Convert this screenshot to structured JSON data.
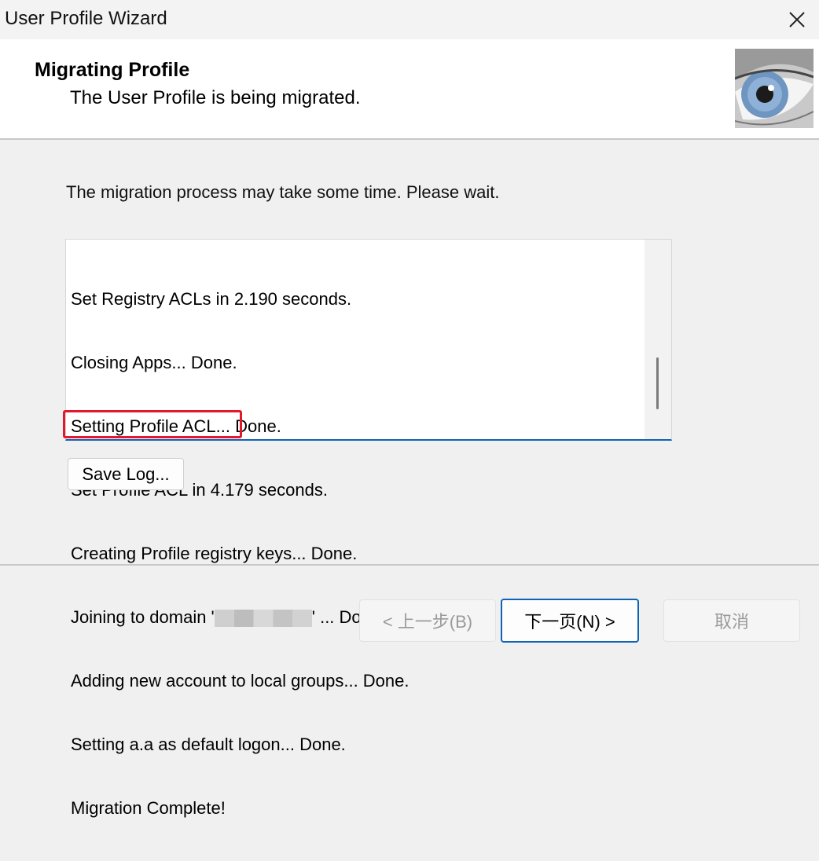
{
  "window": {
    "title": "User Profile Wizard"
  },
  "header": {
    "title": "Migrating Profile",
    "subtitle": "The User Profile is being migrated."
  },
  "main": {
    "intro": "The migration process may take some time. Please wait.",
    "log_lines": [
      "Set Registry ACLs in 2.190 seconds.",
      "Closing Apps... Done.",
      "Setting Profile ACL... Done.",
      "Set Profile ACL in 4.179 seconds.",
      "Creating Profile registry keys... Done.",
      "Joining to domain '",
      "' ... Done.",
      "Adding new account to local groups... Done.",
      "Setting a.a as default logon... Done.",
      "Migration Complete!"
    ],
    "save_log_label": "Save Log..."
  },
  "footer": {
    "back_label": "< 上一步(B)",
    "next_label": "下一页(N) >",
    "cancel_label": "取消"
  },
  "colors": {
    "accent": "#1063b4",
    "highlight": "#e5182b"
  },
  "icons": {
    "close": "close-icon",
    "header_image": "eye-image"
  }
}
